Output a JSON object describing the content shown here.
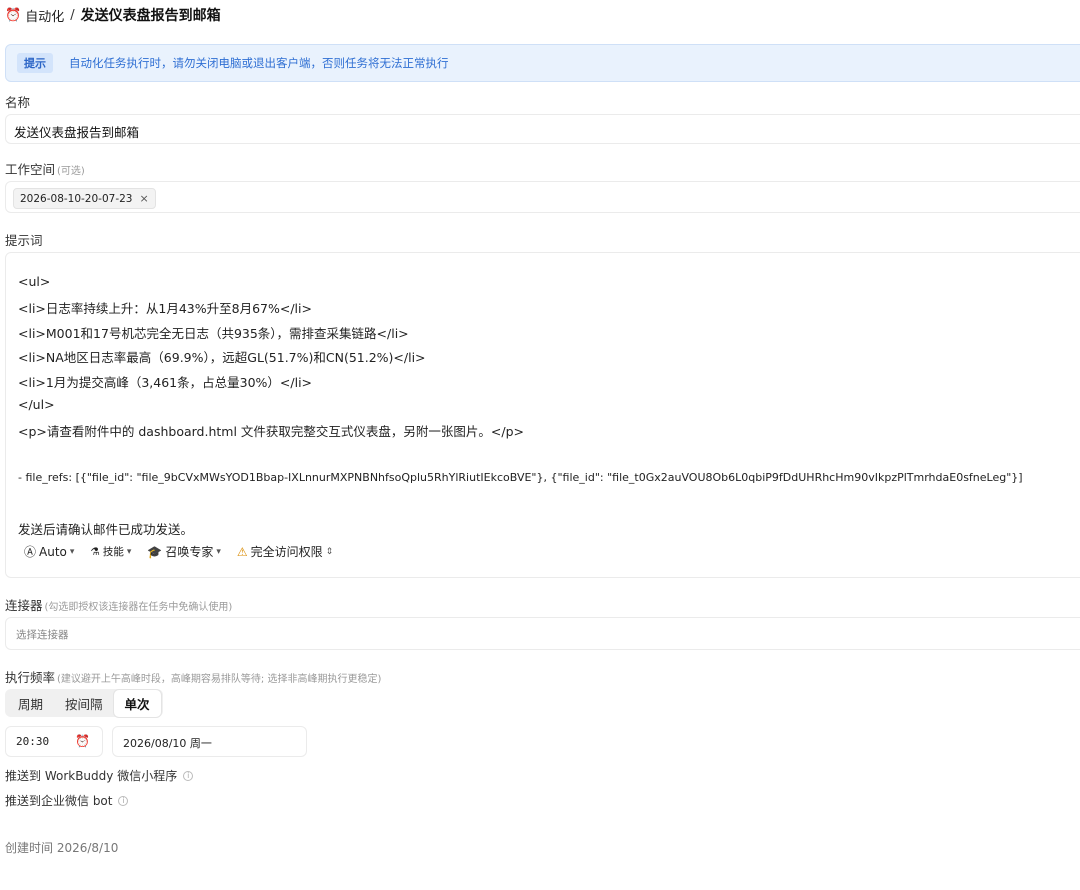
{
  "breadcrumb": {
    "icon": "alarm-clock-icon",
    "parent": "自动化",
    "separator": "/",
    "current": "发送仪表盘报告到邮箱"
  },
  "banner": {
    "tag": "提示",
    "message": "自动化任务执行时，请勿关闭电脑或退出客户端，否则任务将无法正常执行"
  },
  "form": {
    "name_label": "名称",
    "name_value": "发送仪表盘报告到邮箱",
    "workspace_label": "工作空间",
    "workspace_hint": "(可选)",
    "workspace_chip": "2026-08-10-20-07-23",
    "workspace_chip_remove": "×",
    "prompt_label": "提示词",
    "prompt_lines": [
      "<ul>",
      "<li>日志率持续上升：从1月43%升至8月67%</li>",
      "<li>M001和17号机芯完全无日志（共935条），需排查采集链路</li>",
      "<li>NA地区日志率最高（69.9%），远超GL(51.7%)和CN(51.2%)</li>",
      "<li>1月为提交高峰（3,461条，占总量30%）</li>",
      "</ul>",
      "<p>请查看附件中的 dashboard.html 文件获取完整交互式仪表盘，另附一张图片。</p>",
      "- file_refs: [{\"file_id\": \"file_9bCVxMWsYOD1Bbap-IXLnnurMXPNBNhfsoQplu5RhYlRiutIEkcoBVE\"}, {\"file_id\": \"file_t0Gx2auVOU8Ob6L0qbiP9fDdUHRhcHm90vIkpzPlTmrhdaE0sfneLeg\"}]",
      "发送后请确认邮件已成功发送。"
    ],
    "prompt_toolbar": {
      "model": "Auto",
      "skills": "技能",
      "expert": "召唤专家",
      "access": "完全访问权限"
    },
    "connector_label": "连接器",
    "connector_hint": "(勾选即授权该连接器在任务中免确认使用)",
    "connector_placeholder": "选择连接器",
    "frequency_label": "执行频率",
    "frequency_hint": "(建议避开上午高峰时段，高峰期容易排队等待; 选择非高峰期执行更稳定)",
    "frequency_options": [
      "周期",
      "按间隔",
      "单次"
    ],
    "frequency_selected": "单次",
    "time_value": "20:30",
    "date_value": "2026/08/10 周一",
    "push_workbuddy": "推送到 WorkBuddy 微信小程序",
    "push_wecom": "推送到企业微信 bot",
    "created": "创建时间 2026/8/10"
  },
  "colors": {
    "banner_bg": "#e9f2fd",
    "banner_text": "#2f6fd3",
    "warning": "#d98a00"
  }
}
